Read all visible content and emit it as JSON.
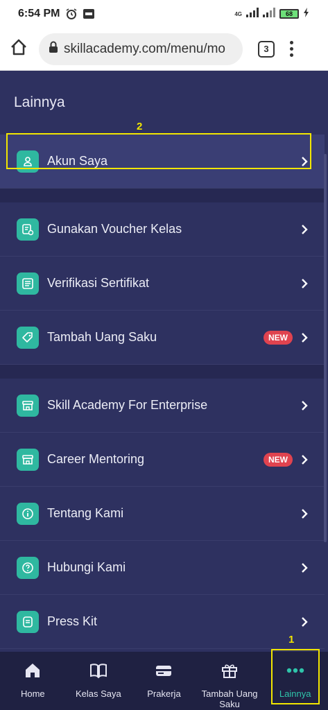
{
  "status_bar": {
    "time": "6:54 PM",
    "network_label": "4G",
    "battery": "68"
  },
  "browser": {
    "url": "skillacademy.com/menu/mo",
    "tab_count": "3"
  },
  "page": {
    "title": "Lainnya"
  },
  "menu": {
    "items": [
      {
        "label": "Akun Saya",
        "icon": "user-icon"
      },
      {
        "label": "Gunakan Voucher Kelas",
        "icon": "voucher-icon"
      },
      {
        "label": "Verifikasi Sertifikat",
        "icon": "certificate-list-icon"
      },
      {
        "label": "Tambah Uang Saku",
        "icon": "tag-icon",
        "badge": "NEW"
      },
      {
        "label": "Skill Academy For Enterprise",
        "icon": "store-icon"
      },
      {
        "label": "Career Mentoring",
        "icon": "store-icon",
        "badge": "NEW"
      },
      {
        "label": "Tentang Kami",
        "icon": "info-icon"
      },
      {
        "label": "Hubungi Kami",
        "icon": "help-icon"
      },
      {
        "label": "Press Kit",
        "icon": "document-icon"
      }
    ]
  },
  "annotations": {
    "label_1": "1",
    "label_2": "2"
  },
  "bottom_nav": {
    "items": [
      {
        "label": "Home",
        "icon": "home-icon"
      },
      {
        "label": "Kelas Saya",
        "icon": "book-icon"
      },
      {
        "label": "Prakerja",
        "icon": "card-icon"
      },
      {
        "label": "Tambah Uang Saku",
        "icon": "gift-icon"
      },
      {
        "label": "Lainnya",
        "icon": "more-dots-icon",
        "active": true
      }
    ]
  },
  "colors": {
    "background": "#2e3160",
    "accent": "#2fb8a0",
    "badge": "#e0434f",
    "annotation": "#f2e600"
  }
}
